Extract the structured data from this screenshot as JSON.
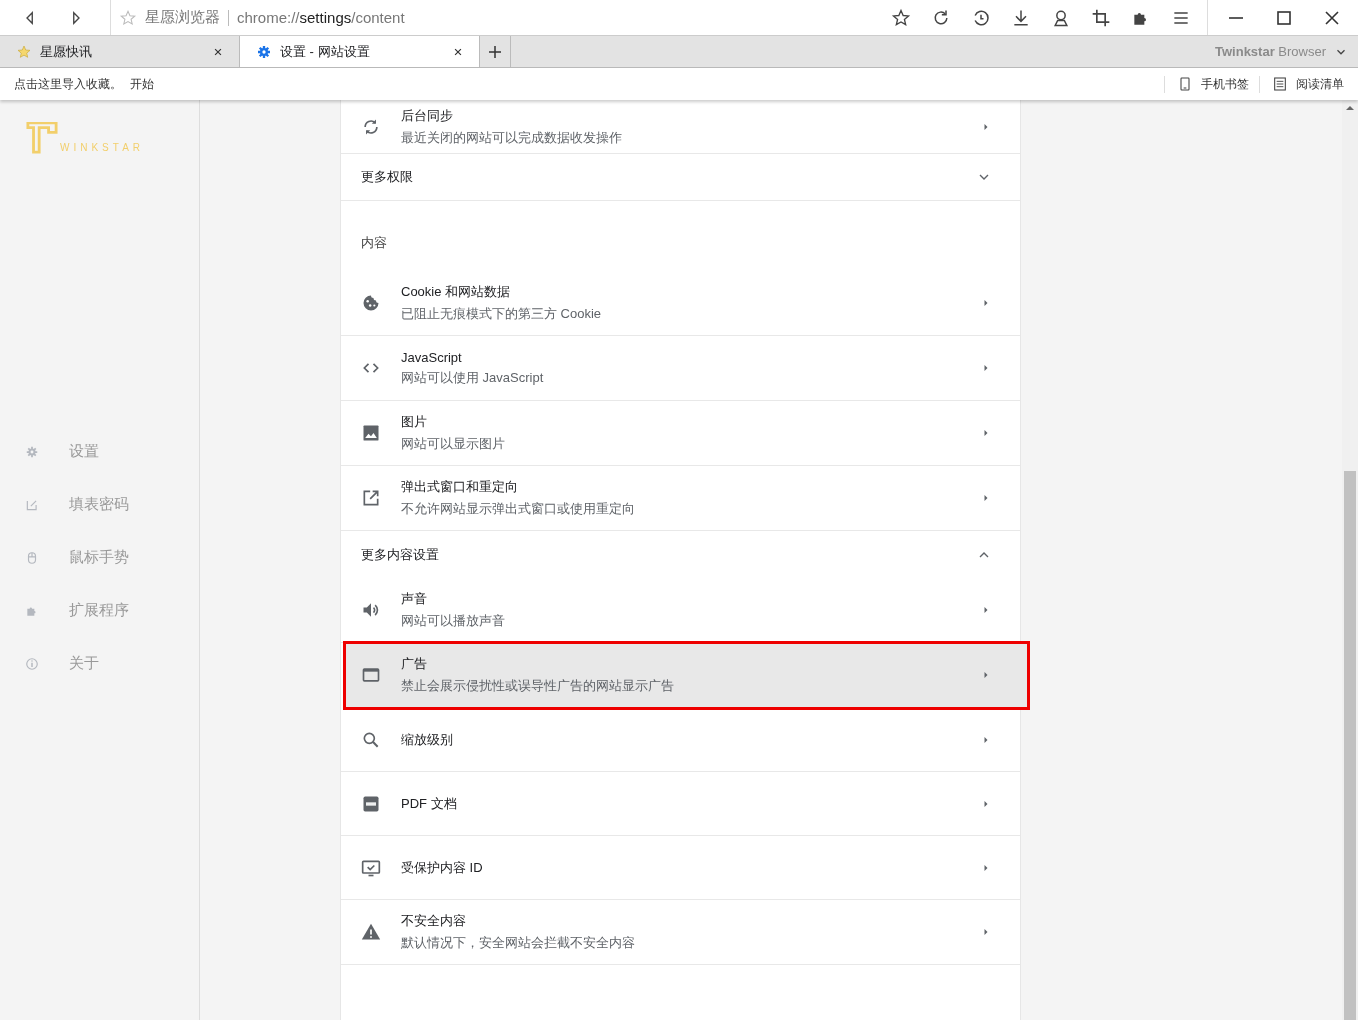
{
  "toolbar": {
    "site_name": "星愿浏览器",
    "url": "chrome://**settings**/content"
  },
  "tabs": [
    {
      "label": "星愿快讯",
      "selected": false
    },
    {
      "label": "设置 - 网站设置",
      "selected": true
    }
  ],
  "brand": "**Twinkstar** Browser",
  "bookmarks_bar": {
    "import_prompt": "点击这里导入收藏。",
    "start_link": "开始",
    "items": [
      "手机书签",
      "阅读清单"
    ]
  },
  "sidebar": {
    "logo_text": "WINKSTAR",
    "items": [
      "设置",
      "填表密码",
      "鼠标手势",
      "扩展程序",
      "关于"
    ]
  },
  "content": {
    "rows": [
      {
        "kind": "item",
        "title": "后台同步",
        "subtitle": "最近关闭的网站可以完成数据收发操作",
        "highlighted": false
      },
      {
        "kind": "section",
        "title": "更多权限",
        "expanded": false
      },
      {
        "kind": "label",
        "title": "内容"
      },
      {
        "kind": "item",
        "title": "Cookie 和网站数据",
        "subtitle": "已阻止无痕模式下的第三方 Cookie",
        "highlighted": false
      },
      {
        "kind": "item",
        "title": "JavaScript",
        "subtitle": "网站可以使用 JavaScript",
        "highlighted": false
      },
      {
        "kind": "item",
        "title": "图片",
        "subtitle": "网站可以显示图片",
        "highlighted": false
      },
      {
        "kind": "item",
        "title": "弹出式窗口和重定向",
        "subtitle": "不允许网站显示弹出式窗口或使用重定向",
        "highlighted": false
      },
      {
        "kind": "section",
        "title": "更多内容设置",
        "expanded": true
      },
      {
        "kind": "item",
        "title": "声音",
        "subtitle": "网站可以播放声音",
        "highlighted": false
      },
      {
        "kind": "item",
        "title": "广告",
        "subtitle": "禁止会展示侵扰性或误导性广告的网站显示广告",
        "highlighted": true
      },
      {
        "kind": "item",
        "title": "缩放级别",
        "highlighted": false
      },
      {
        "kind": "item",
        "title": "PDF 文档",
        "highlighted": false
      },
      {
        "kind": "item",
        "title": "受保护内容 ID",
        "highlighted": false
      },
      {
        "kind": "item",
        "title": "不安全内容",
        "subtitle": "默认情况下，安全网站会拦截不安全内容",
        "highlighted": false
      }
    ]
  }
}
